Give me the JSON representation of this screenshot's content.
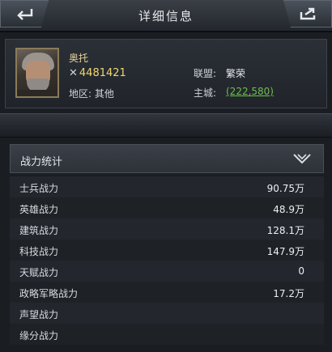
{
  "window": {
    "title": "详细信息"
  },
  "profile": {
    "name": "奥托",
    "power": "4481421",
    "region_label": "地区: 其他",
    "alliance_label": "联盟:",
    "alliance_value": "繁荣",
    "city_label": "主城:",
    "city_value": "(222,580)"
  },
  "stats": {
    "header": "战力统计",
    "rows": [
      {
        "label": "士兵战力",
        "value": "90.75万"
      },
      {
        "label": "英雄战力",
        "value": "48.9万"
      },
      {
        "label": "建筑战力",
        "value": "128.1万"
      },
      {
        "label": "科技战力",
        "value": "147.9万"
      },
      {
        "label": "天赋战力",
        "value": "0"
      },
      {
        "label": "政略军略战力",
        "value": "17.2万"
      },
      {
        "label": "声望战力",
        "value": ""
      },
      {
        "label": "缘分战力",
        "value": ""
      }
    ]
  },
  "icons": {
    "back": "back-arrow-icon",
    "share": "share-icon",
    "collapse": "chevron-down-icon",
    "power": "crossed-swords-icon"
  },
  "colors": {
    "power": "#f0d870",
    "city_link": "#6fbf4e",
    "name": "#e7d29a"
  }
}
